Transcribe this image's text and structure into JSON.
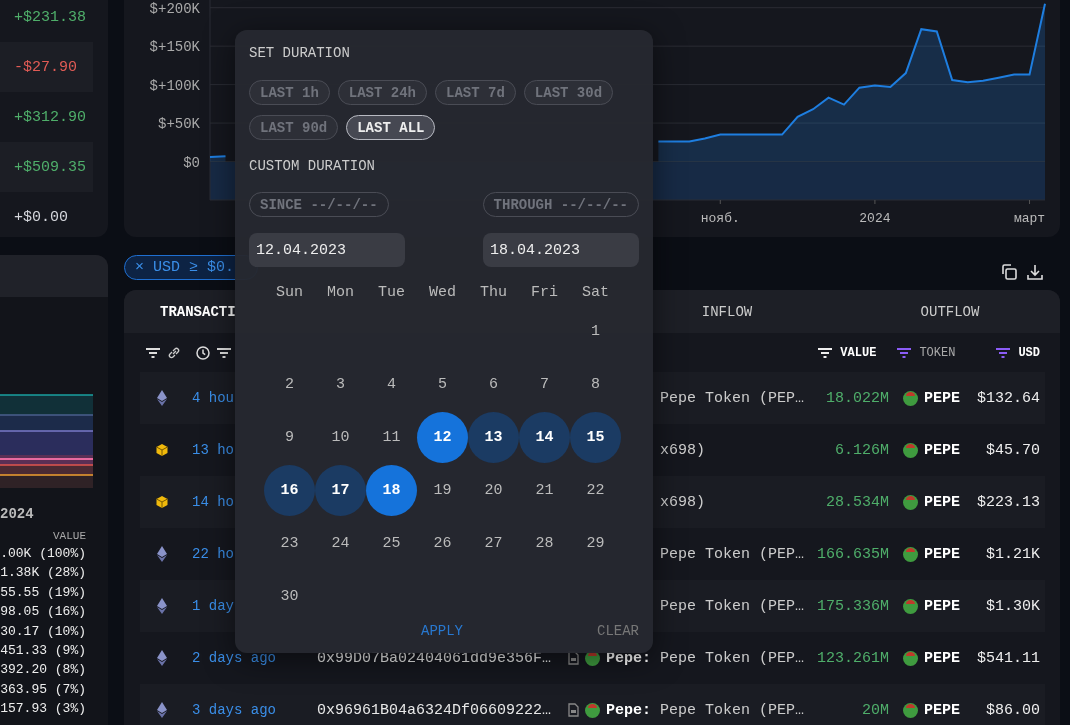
{
  "balance_changes": [
    {
      "text": "+$231.38",
      "color": "#4fae6a"
    },
    {
      "text": "-$27.90",
      "color": "#e05b55"
    },
    {
      "text": "+$312.90",
      "color": "#4fae6a"
    },
    {
      "text": "+$509.35",
      "color": "#4fae6a"
    },
    {
      "text": "+$0.00",
      "color": "#d4d6dc"
    }
  ],
  "left_panel": {
    "axis_label": "2024",
    "value_header": "VALUE",
    "values": [
      ".00K (100%)",
      "1.38K (28%)",
      "55.55 (19%)",
      "98.05 (16%)",
      "30.17 (10%)",
      "451.33 (9%)",
      "392.20 (8%)",
      "363.95 (7%)",
      "157.93 (3%)"
    ]
  },
  "chart": {
    "chart_data": {
      "type": "area",
      "categories": [
        null,
        null,
        null,
        null,
        null,
        null,
        null,
        null,
        null,
        null,
        null,
        null,
        null,
        null,
        null,
        null,
        null,
        null,
        null,
        null,
        null,
        null,
        null,
        null,
        null,
        null,
        null,
        null,
        null,
        null,
        null,
        null,
        null,
        "нояб.",
        null,
        null,
        null,
        null,
        null,
        null,
        null,
        null,
        null,
        "2024",
        null,
        null,
        null,
        null,
        null,
        null,
        null,
        null,
        null,
        "март",
        null
      ],
      "series": [
        {
          "color": "#1e7ee0",
          "values": [
            6000,
            7000,
            null,
            null,
            null,
            null,
            null,
            null,
            null,
            null,
            null,
            null,
            null,
            null,
            null,
            null,
            null,
            null,
            null,
            null,
            null,
            null,
            null,
            null,
            null,
            null,
            null,
            null,
            null,
            26000,
            26000,
            26000,
            30000,
            35000,
            35000,
            35000,
            35000,
            35000,
            58000,
            68000,
            83000,
            74000,
            96000,
            99000,
            97000,
            115000,
            172000,
            169000,
            106000,
            103000,
            105000,
            109000,
            113000,
            113000,
            205000
          ]
        }
      ],
      "ylim": [
        -50000,
        210000
      ],
      "grid": true,
      "yticks": [
        {
          "value": 0,
          "label": "$0"
        },
        {
          "value": 50000,
          "label": "$+50K"
        },
        {
          "value": 100000,
          "label": "$+100K"
        },
        {
          "value": 150000,
          "label": "$+150K"
        },
        {
          "value": 200000,
          "label": "$+200K"
        }
      ]
    }
  },
  "filter_chip": {
    "remove": "×",
    "label": "USD ≥ $0."
  },
  "table": {
    "groups": [
      "TRANSACTI",
      "INFLOW",
      "OUTFLOW"
    ],
    "columns": [
      {
        "label": "VALUE",
        "filtered": false,
        "active": true
      },
      {
        "label": "TOKEN",
        "filtered": true,
        "active": false
      },
      {
        "label": "USD",
        "filtered": true,
        "active": true
      }
    ],
    "rows": [
      {
        "kind": "eth",
        "time": "4 hou",
        "entity": "Pepe Token (PEP…",
        "value": "18.022M",
        "token": "PEPE",
        "usd": "$132.64"
      },
      {
        "kind": "bnb",
        "time": "13 ho",
        "entity": "x698)",
        "value": "6.126M",
        "token": "PEPE",
        "usd": "$45.70"
      },
      {
        "kind": "bnb",
        "time": "14 ho",
        "entity": "x698)",
        "value": "28.534M",
        "token": "PEPE",
        "usd": "$223.13"
      },
      {
        "kind": "eth",
        "time": "22 ho",
        "entity": "Pepe Token (PEP…",
        "value": "166.635M",
        "token": "PEPE",
        "usd": "$1.21K"
      },
      {
        "kind": "eth",
        "time": "1 day",
        "entity": "Pepe Token (PEP…",
        "value": "175.336M",
        "token": "PEPE",
        "usd": "$1.30K"
      },
      {
        "kind": "eth",
        "time": "2 days ago",
        "address": "0x99D07Ba02404061dd9e356F…",
        "contract": true,
        "entity_label": "Pepe:",
        "entity": "Pepe Token (PEP…",
        "value": "123.261M",
        "token": "PEPE",
        "usd": "$541.11"
      },
      {
        "kind": "eth",
        "time": "3 days ago",
        "address": "0x96961B04a6324Df06609222…",
        "contract": true,
        "entity_label": "Pepe:",
        "entity": "Pepe Token (PEP…",
        "value": "20M",
        "token": "PEPE",
        "usd": "$86.00"
      }
    ]
  },
  "date_popup": {
    "set_title": "SET DURATION",
    "presets": [
      {
        "label": "LAST 1h",
        "selected": false
      },
      {
        "label": "LAST 24h",
        "selected": false
      },
      {
        "label": "LAST 7d",
        "selected": false
      },
      {
        "label": "LAST 30d",
        "selected": false
      },
      {
        "label": "LAST 90d",
        "selected": false
      },
      {
        "label": "LAST ALL",
        "selected": true
      }
    ],
    "custom_title": "CUSTOM DURATION",
    "since": "SINCE --/--/--",
    "through": "THROUGH --/--/--",
    "start_date": "12.04.2023",
    "end_date": "18.04.2023",
    "weekdays": [
      "Sun",
      "Mon",
      "Tue",
      "Wed",
      "Thu",
      "Fri",
      "Sat"
    ],
    "days": [
      {
        "kind": "blank"
      },
      {
        "kind": "blank"
      },
      {
        "kind": "blank"
      },
      {
        "kind": "blank"
      },
      {
        "kind": "blank"
      },
      {
        "kind": "blank"
      },
      {
        "kind": "day",
        "label": "1",
        "selected": false,
        "in_range": false
      },
      {
        "kind": "day",
        "label": "2",
        "selected": false,
        "in_range": false
      },
      {
        "kind": "day",
        "label": "3",
        "selected": false,
        "in_range": false
      },
      {
        "kind": "day",
        "label": "4",
        "selected": false,
        "in_range": false
      },
      {
        "kind": "day",
        "label": "5",
        "selected": false,
        "in_range": false
      },
      {
        "kind": "day",
        "label": "6",
        "selected": false,
        "in_range": false
      },
      {
        "kind": "day",
        "label": "7",
        "selected": false,
        "in_range": false
      },
      {
        "kind": "day",
        "label": "8",
        "selected": false,
        "in_range": false
      },
      {
        "kind": "day",
        "label": "9",
        "selected": false,
        "in_range": false
      },
      {
        "kind": "day",
        "label": "10",
        "selected": false,
        "in_range": false
      },
      {
        "kind": "day",
        "label": "11",
        "selected": false,
        "in_range": false
      },
      {
        "kind": "day",
        "label": "12",
        "selected": true,
        "in_range": true
      },
      {
        "kind": "day",
        "label": "13",
        "selected": false,
        "in_range": true
      },
      {
        "kind": "day",
        "label": "14",
        "selected": false,
        "in_range": true
      },
      {
        "kind": "day",
        "label": "15",
        "selected": false,
        "in_range": true
      },
      {
        "kind": "day",
        "label": "16",
        "selected": false,
        "in_range": true
      },
      {
        "kind": "day",
        "label": "17",
        "selected": false,
        "in_range": true
      },
      {
        "kind": "day",
        "label": "18",
        "selected": true,
        "in_range": true
      },
      {
        "kind": "day",
        "label": "19",
        "selected": false,
        "in_range": false
      },
      {
        "kind": "day",
        "label": "20",
        "selected": false,
        "in_range": false
      },
      {
        "kind": "day",
        "label": "21",
        "selected": false,
        "in_range": false
      },
      {
        "kind": "day",
        "label": "22",
        "selected": false,
        "in_range": false
      },
      {
        "kind": "day",
        "label": "23",
        "selected": false,
        "in_range": false
      },
      {
        "kind": "day",
        "label": "24",
        "selected": false,
        "in_range": false
      },
      {
        "kind": "day",
        "label": "25",
        "selected": false,
        "in_range": false
      },
      {
        "kind": "day",
        "label": "26",
        "selected": false,
        "in_range": false
      },
      {
        "kind": "day",
        "label": "27",
        "selected": false,
        "in_range": false
      },
      {
        "kind": "day",
        "label": "28",
        "selected": false,
        "in_range": false
      },
      {
        "kind": "day",
        "label": "29",
        "selected": false,
        "in_range": false
      },
      {
        "kind": "day",
        "label": "30",
        "selected": false,
        "in_range": false
      }
    ],
    "apply": "APPLY",
    "clear": "CLEAR"
  }
}
